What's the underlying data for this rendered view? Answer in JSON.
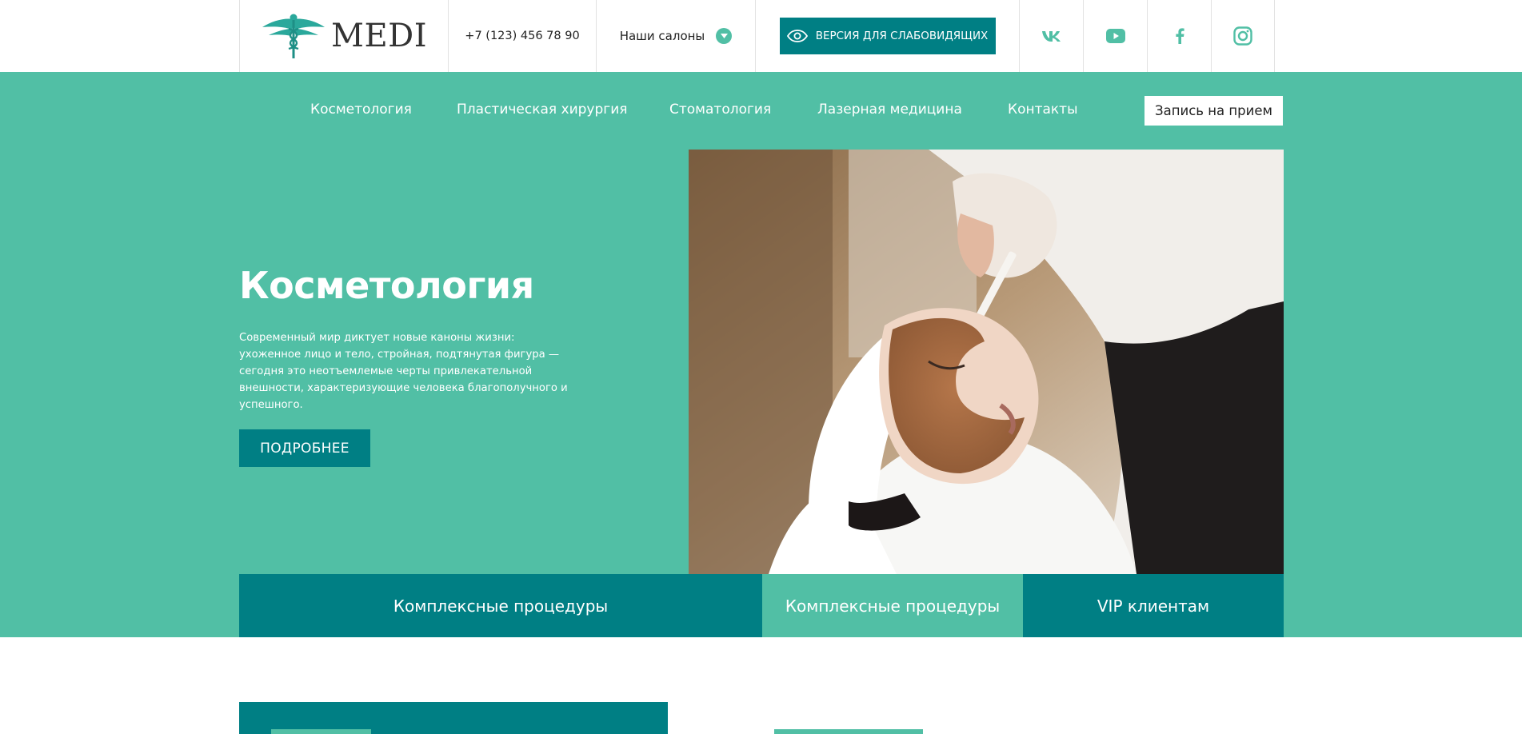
{
  "header": {
    "logo_text": "MEDI",
    "phone": "+7 (123) 456 78 90",
    "salons_label": "Наши салоны",
    "vision_button": "ВЕРСИЯ ДЛЯ СЛАБОВИДЯЩИХ",
    "social": [
      "vk-icon",
      "youtube-icon",
      "facebook-icon",
      "instagram-icon"
    ]
  },
  "nav": {
    "items": [
      {
        "label": "Косметология"
      },
      {
        "label": "Пластическая хирургия"
      },
      {
        "label": "Стоматология"
      },
      {
        "label": "Лазерная медицина"
      },
      {
        "label": "Контакты"
      }
    ],
    "book_button": "Запись на прием"
  },
  "hero": {
    "title": "Косметология",
    "text": "Современный мир диктует новые каноны жизни: ухоженное лицо и тело, стройная, подтянутая фигура — сегодня это неотъемлемые черты привлекательной внешности, характеризующие человека благополучного и успешного.",
    "more_button": "ПОДРОБНЕЕ"
  },
  "tabs": [
    {
      "label": "Комплексные процедуры"
    },
    {
      "label": "Комплексные процедуры"
    },
    {
      "label": "VIP клиентам"
    }
  ],
  "colors": {
    "accent": "#51bfa5",
    "dark_teal": "#007f84",
    "white": "#ffffff"
  }
}
